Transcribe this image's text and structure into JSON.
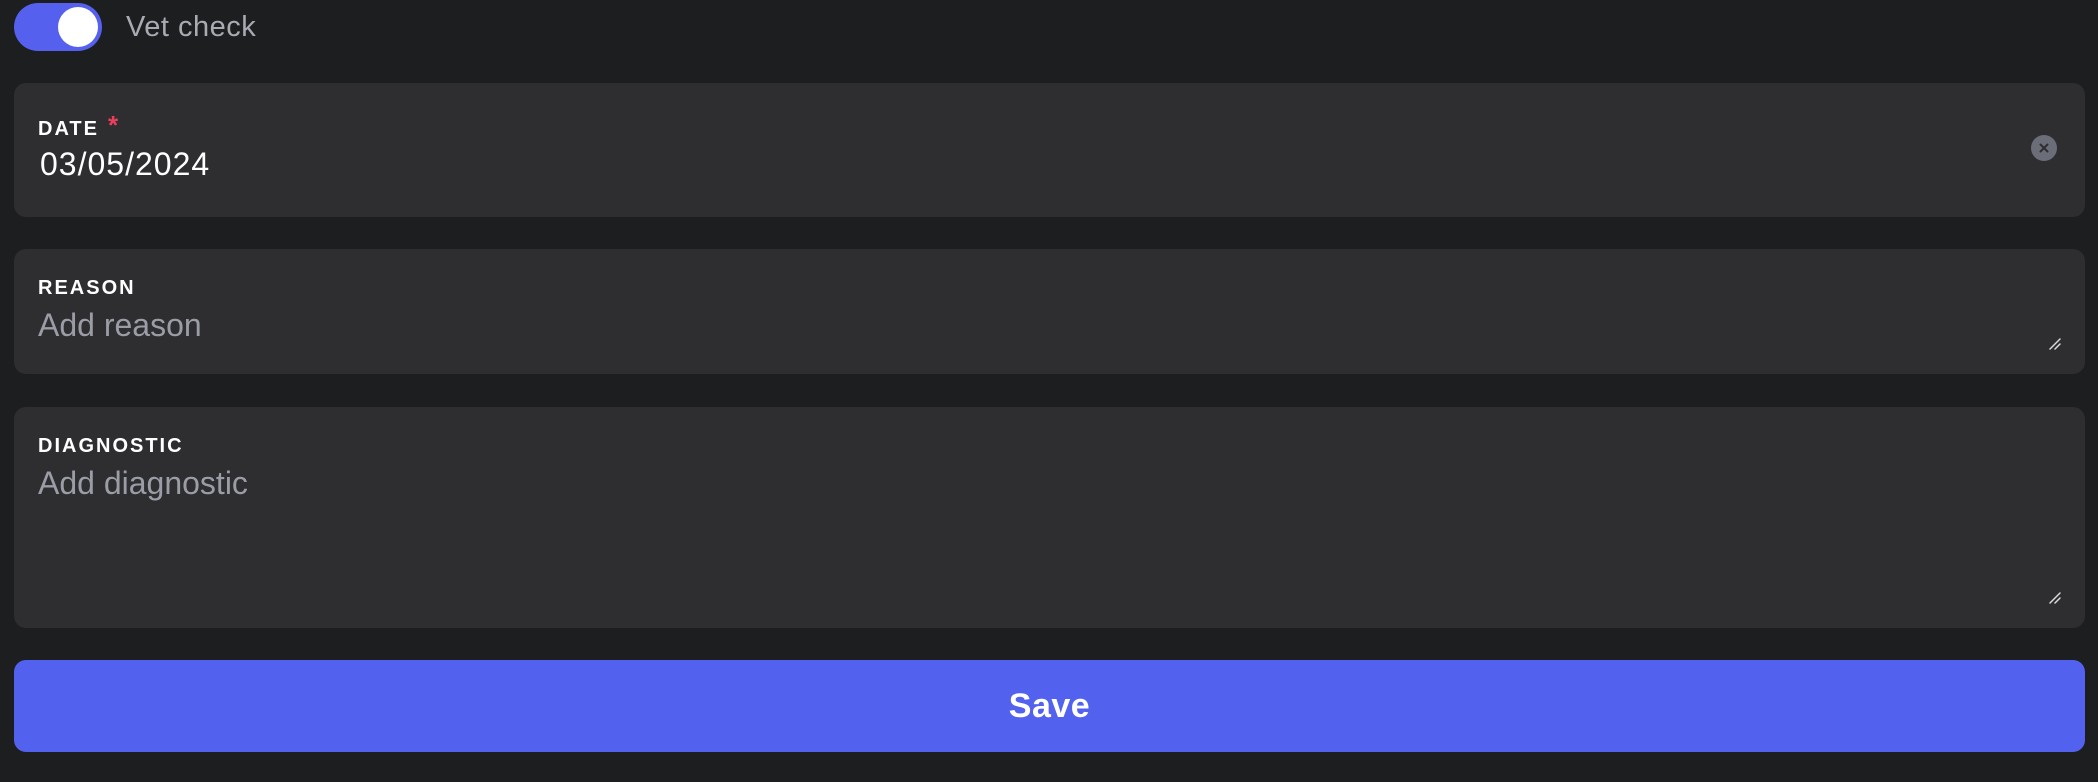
{
  "vet_check": {
    "label": "Vet check",
    "enabled": true,
    "accent_color": "#5560ee"
  },
  "date_field": {
    "label": "DATE",
    "required_marker": "*",
    "value": "03/05/2024",
    "clear_icon": "close-circle-icon"
  },
  "reason_field": {
    "label": "REASON",
    "value": "",
    "placeholder": "Add reason",
    "resize_icon": "resize-handle-icon"
  },
  "diagnostic_field": {
    "label": "DIAGNOSTIC",
    "value": "",
    "placeholder": "Add diagnostic",
    "resize_icon": "resize-handle-icon"
  },
  "actions": {
    "save_label": "Save",
    "save_color": "#5361ef"
  },
  "colors": {
    "background": "#1d1e20",
    "card": "#2e2e31",
    "required": "#ee3d5d"
  }
}
